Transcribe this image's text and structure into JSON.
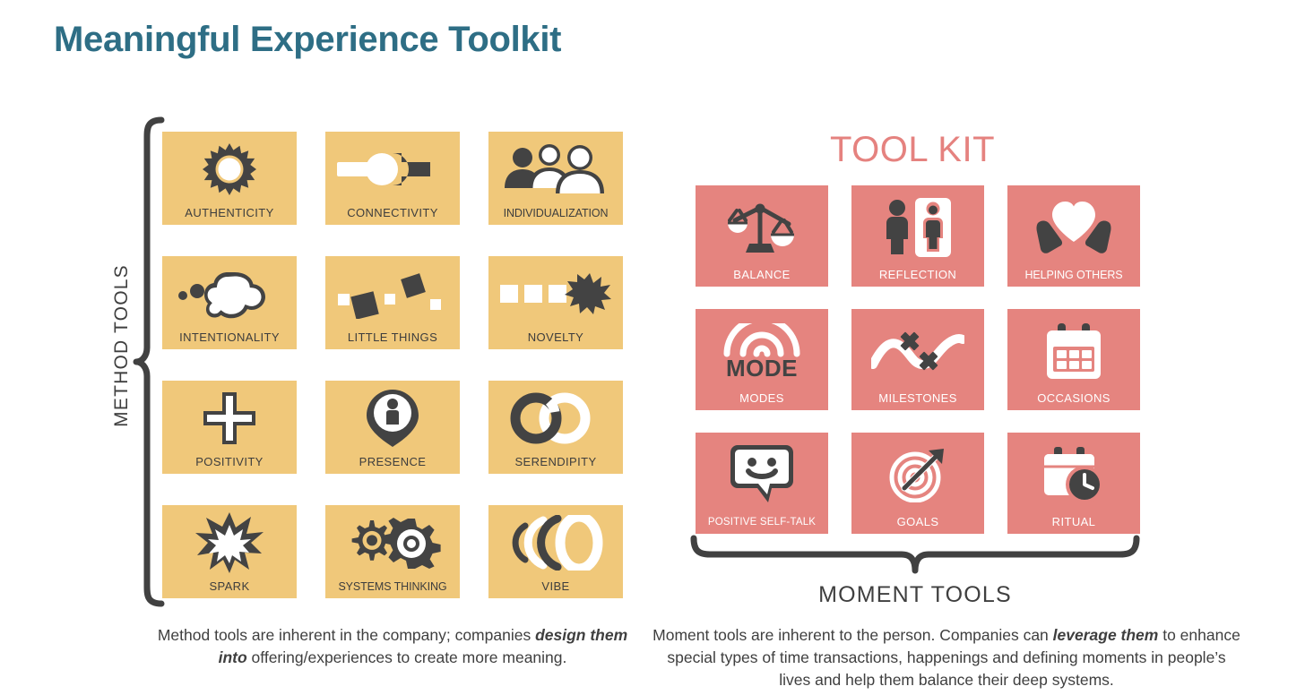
{
  "page": {
    "title": "Meaningful Experience Toolkit",
    "title_color": "#2E6E85",
    "background_color": "#FFFFFF"
  },
  "method_section": {
    "axis_label": "METHOD TOOLS",
    "tile_color": "#F0C87A",
    "label_color": "#3D3D3D",
    "tiles": [
      {
        "label": "AUTHENTICITY",
        "icon": "sun-icon"
      },
      {
        "label": "CONNECTIVITY",
        "icon": "plug-connector-icon"
      },
      {
        "label": "INDIVIDUALIZATION",
        "icon": "three-people-icon"
      },
      {
        "label": "INTENTIONALITY",
        "icon": "thought-cloud-icon"
      },
      {
        "label": "LITTLE THINGS",
        "icon": "scattered-squares-icon"
      },
      {
        "label": "NOVELTY",
        "icon": "squares-with-burst-icon"
      },
      {
        "label": "POSITIVITY",
        "icon": "plus-cross-icon"
      },
      {
        "label": "PRESENCE",
        "icon": "location-pin-person-icon"
      },
      {
        "label": "SERENDIPITY",
        "icon": "interlocking-rings-icon"
      },
      {
        "label": "SPARK",
        "icon": "starburst-icon"
      },
      {
        "label": "SYSTEMS THINKING",
        "icon": "two-gears-icon"
      },
      {
        "label": "VIBE",
        "icon": "sound-waves-icon"
      }
    ],
    "caption_part1": "Method tools are inherent in the company; companies ",
    "caption_emphasis1": "design them into",
    "caption_part2": " offering/experiences to create more meaning."
  },
  "moment_section": {
    "heading": "TOOL KIT",
    "heading_color": "#E5827F",
    "axis_label": "MOMENT TOOLS",
    "tile_color": "#E5847F",
    "label_color": "#FFFFFF",
    "tiles": [
      {
        "label": "BALANCE",
        "icon": "balance-scale-icon"
      },
      {
        "label": "REFLECTION",
        "icon": "person-mirror-icon"
      },
      {
        "label": "HELPING OTHERS",
        "icon": "heart-in-hands-icon"
      },
      {
        "label": "MODES",
        "icon": "mode-gauge-icon"
      },
      {
        "label": "MILESTONES",
        "icon": "path-with-x-marks-icon"
      },
      {
        "label": "OCCASIONS",
        "icon": "calendar-icon"
      },
      {
        "label": "POSITIVE SELF-TALK",
        "icon": "smiley-speech-bubble-icon"
      },
      {
        "label": "GOALS",
        "icon": "target-arrow-icon"
      },
      {
        "label": "RITUAL",
        "icon": "calendar-clock-icon"
      }
    ],
    "caption_part1": "Moment tools are inherent to the person. Companies can ",
    "caption_emphasis1": "leverage them",
    "caption_part2": " to enhance special types of time transactions, happenings and defining moments in people’s lives and help them balance their deep systems."
  }
}
